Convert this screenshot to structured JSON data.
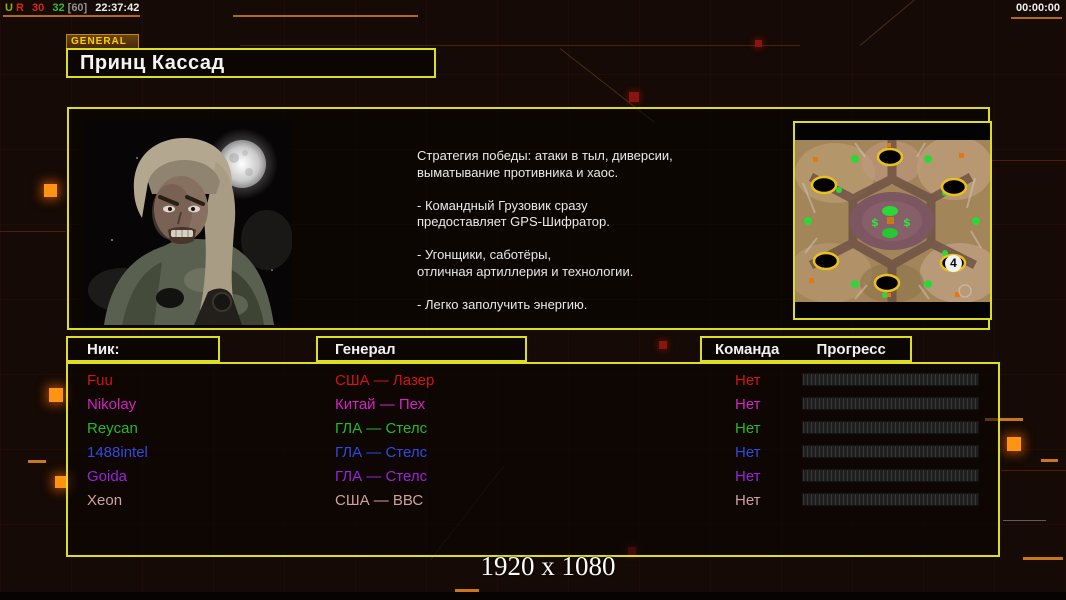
{
  "top_overlay": {
    "segments": [
      {
        "text": "U",
        "color": "#8fae1c"
      },
      {
        "text": "R",
        "color": "#d42818"
      },
      {
        "text": "30",
        "color": "#d42818"
      },
      {
        "text": "32",
        "color": "#38b838"
      },
      {
        "text": "[60]",
        "color": "#8f8f8f"
      },
      {
        "text": "22:37:42",
        "color": "#efefef"
      }
    ],
    "match_timer": "00:00:00"
  },
  "general_tab": {
    "label": "GENERAL"
  },
  "title": "Принц Кассад",
  "briefing": {
    "text": "Стратегия победы: атаки в тыл, диверсии,\n выматывание противника и хаос.\n\n- Командный Грузовик сразу\nпредоставляет GPS-Шифратор.\n\n- Угонщики, саботёры,\nотличная артиллерия и технологии.\n\n- Легко заполучить энергию."
  },
  "minimap": {
    "start_badge": "4"
  },
  "table": {
    "headers": {
      "nick": "Ник:",
      "general": "Генерал",
      "team": "Команда",
      "progress": "Прогресс"
    },
    "players": [
      {
        "nick": "Fuu",
        "general": "США — Лазер",
        "team": "Нет",
        "color": "#d41414",
        "progress": 0
      },
      {
        "nick": "Nikolay",
        "general": "Китай — Пех",
        "team": "Нет",
        "color": "#d422c8",
        "progress": 0
      },
      {
        "nick": "Reycan",
        "general": "ГЛА — Стелс",
        "team": "Нет",
        "color": "#28b828",
        "progress": 0
      },
      {
        "nick": "1488intel",
        "general": "ГЛА — Стелс",
        "team": "Нет",
        "color": "#3448e0",
        "progress": 0
      },
      {
        "nick": "Goida",
        "general": "ГЛА — Стелс",
        "team": "Нет",
        "color": "#9a22dd",
        "progress": 0
      },
      {
        "nick": "Xeon",
        "general": "США — ВВС",
        "team": "Нет",
        "color": "#cfa0a0",
        "progress": 0
      }
    ]
  },
  "footer": {
    "resolution": "1920 x 1080"
  },
  "colors": {
    "accent_border": "#dede20",
    "glow_orange": "#ff9314",
    "background": "#150a05"
  }
}
